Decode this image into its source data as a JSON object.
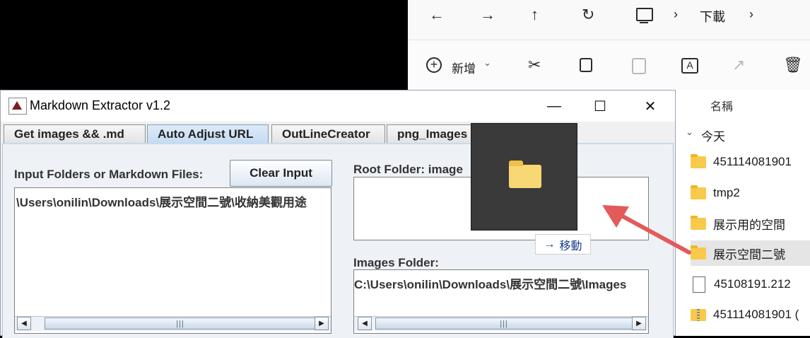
{
  "explorer": {
    "nav": {
      "back": "←",
      "forward": "→",
      "up": "↑",
      "refresh": "↻"
    },
    "breadcrumb": {
      "separator": "›",
      "location": "下載"
    },
    "toolbar": {
      "new_label": "新增",
      "new_chevron": "⌄"
    },
    "header": {
      "name_column": "名稱",
      "group_chevron": "⌄",
      "group_today": "今天"
    },
    "files": [
      {
        "name": "451114081901",
        "type": "folder"
      },
      {
        "name": "tmp2",
        "type": "folder"
      },
      {
        "name": "展示用的空間",
        "type": "folder"
      },
      {
        "name": "展示空間二號",
        "type": "folder",
        "selected": true
      },
      {
        "name": "45108191.212",
        "type": "file"
      },
      {
        "name": "451114081901 (",
        "type": "zip"
      }
    ]
  },
  "app": {
    "title": "Markdown Extractor v1.2",
    "controls": {
      "minimize": "—",
      "maximize": "☐",
      "close": "✕"
    },
    "tabs": [
      {
        "label": "Get images && .md",
        "active": false
      },
      {
        "label": "Auto Adjust URL",
        "active": true
      },
      {
        "label": "OutLineCreator",
        "active": false
      },
      {
        "label": "png_Images",
        "active": false
      }
    ],
    "input_label": "Input Folders or Markdown Files:",
    "clear_button": "Clear Input",
    "input_value": "\\Users\\onilin\\Downloads\\展示空間二號\\收納美觀用途",
    "root_label": "Root Folder: image",
    "root_value": "",
    "images_label": "Images Folder:",
    "images_value": "C:\\Users\\onilin\\Downloads\\展示空間二號\\Images",
    "scroll": {
      "left": "◀",
      "right": "▶",
      "grip": "|||"
    }
  },
  "drag": {
    "tooltip_arrow": "→",
    "tooltip_label": "移動"
  },
  "colors": {
    "accent_arrow": "#e25a5a",
    "tab_active": "#c5dbf1",
    "selected_row": "#e5e5e5"
  }
}
